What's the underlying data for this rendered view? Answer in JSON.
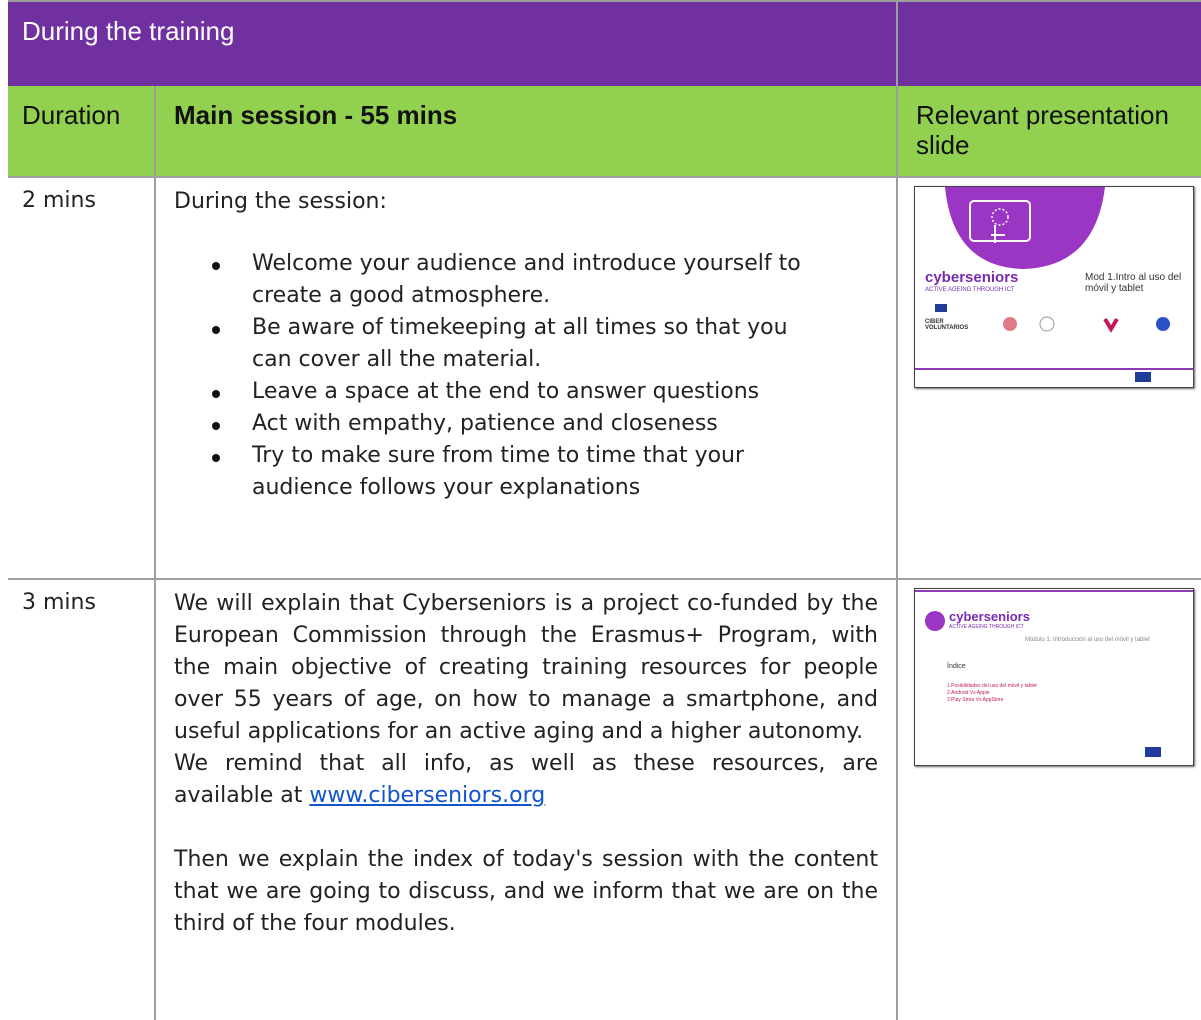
{
  "header": {
    "title": "During the training"
  },
  "columns": {
    "duration": "Duration",
    "main": "Main session - 55 mins",
    "slide": "Relevant presentation slide"
  },
  "rows": [
    {
      "duration": "2 mins",
      "intro": "During  the session:",
      "bullets": [
        "Welcome your audience and introduce yourself to create a good atmosphere.",
        "Be aware of timekeeping at all times so that you can cover all the material.",
        "Leave a space at the end to answer questions",
        "Act with empathy, patience and closeness",
        "Try to make sure from time to time that your audience follows your explanations"
      ],
      "slide": {
        "brand": "cyberseniors",
        "tagline": "ACTIVE AGEING THROUGH ICT",
        "title": "Mod 1.Intro al uso del móvil y tablet",
        "partner_label": "CIBER VOLUNTARIOS"
      }
    },
    {
      "duration": "3 mins",
      "para1": "We will explain that Cyberseniors is a project co-funded by the European Commission through the Erasmus+ Program, with the main objective of creating training resources for people over 55 years of age, on how to manage a smartphone, and useful applications for an active aging and a higher autonomy.",
      "para2_prefix": "We remind that all info, as well as these resources, are available at ",
      "link": "www.ciberseniors.org",
      "para3": "Then we explain the  index of today's session with the content that we are going to discuss, and we inform that we are on the third of the four modules.",
      "slide": {
        "brand": "cyberseniors",
        "tagline": "ACTIVE AGEING THROUGH ICT",
        "subtitle": "Módulo 1. Introducción al uso del móvil y tablet",
        "index_label": "Índice",
        "items": [
          "1.Posibilidades del uso del móvil y tablet",
          "2.Android Vs Apple",
          "3.Play Store Vs AppStore"
        ]
      }
    }
  ],
  "colors": {
    "header": "#7030a0",
    "subheader": "#92d050",
    "link": "#1155cc",
    "brand": "#7a2ab0"
  }
}
